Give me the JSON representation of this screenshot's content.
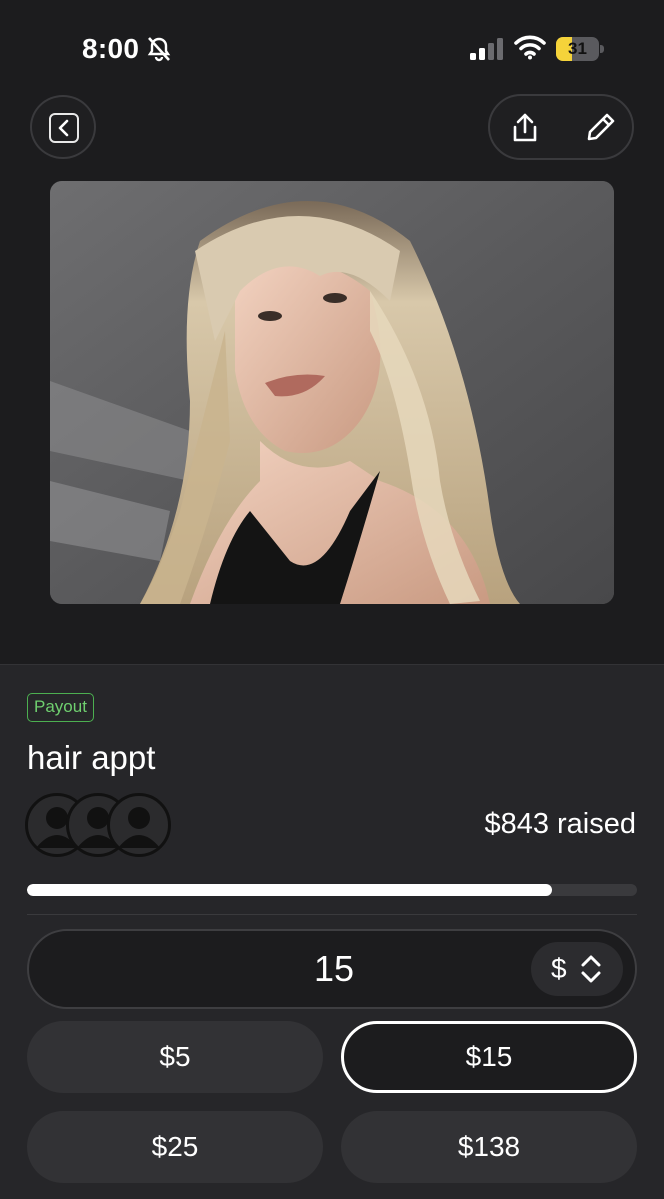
{
  "status_bar": {
    "time": "8:00",
    "battery_level": "31"
  },
  "campaign": {
    "badge": "Payout",
    "title": "hair appt",
    "raised_text": "$843 raised",
    "progress_fraction": 0.86
  },
  "amount": {
    "value": "15",
    "currency_symbol": "$"
  },
  "presets": [
    {
      "label": "$5",
      "selected": false
    },
    {
      "label": "$15",
      "selected": true
    },
    {
      "label": "$25",
      "selected": false
    },
    {
      "label": "$138",
      "selected": false
    }
  ],
  "colors": {
    "background": "#1c1c1e",
    "card": "#262629",
    "badge_green": "#4caf50",
    "battery_yellow": "#f5d33a"
  },
  "icons": [
    "bell-slash-icon",
    "signal-icon",
    "wifi-icon",
    "battery-icon",
    "chevron-left-icon",
    "share-icon",
    "pencil-icon",
    "person-icon",
    "chevron-up-down-icon"
  ]
}
